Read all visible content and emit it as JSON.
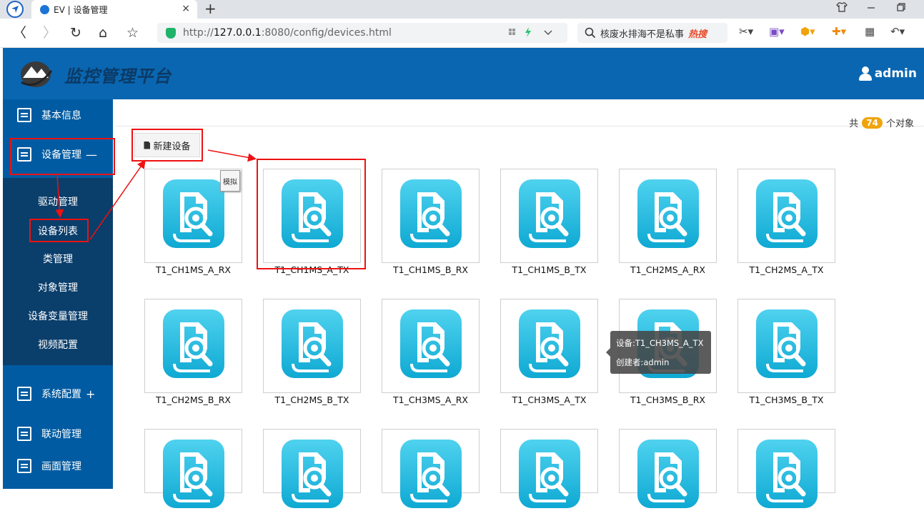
{
  "browser": {
    "tab_title": "EV | 设备管理",
    "tab_close": "×",
    "new_tab": "+",
    "url_scheme": "http://",
    "url_host": "127.0.0.1",
    "url_rest": ":8080/config/devices.html",
    "search_text": "核废水排海不是私事",
    "search_hot": "热搜",
    "nav": {
      "back": "〈",
      "forward": "〉",
      "reload": "↻",
      "home": "⌂",
      "star": "☆"
    },
    "icons": [
      "cut-icon",
      "translate-icon",
      "coin-icon",
      "game-icon",
      "apps-icon",
      "undo-icon"
    ]
  },
  "header": {
    "title": "监控管理平台",
    "user": "admin"
  },
  "sidebar": {
    "items": [
      {
        "label": "基本信息",
        "sign": ""
      },
      {
        "label": "设备管理",
        "sign": "—"
      },
      {
        "label": "系统配置",
        "sign": "+"
      },
      {
        "label": "联动管理",
        "sign": ""
      },
      {
        "label": "画面管理",
        "sign": ""
      }
    ],
    "submenu": [
      "驱动管理",
      "设备列表",
      "类管理",
      "对象管理",
      "设备变量管理",
      "视频配置"
    ]
  },
  "toolbar": {
    "new_device": "新建设备"
  },
  "summary": {
    "prefix": "共",
    "count": "74",
    "suffix": "个对象"
  },
  "sim_badge": "模拟",
  "devices": [
    "T1_CH1MS_A_RX",
    "T1_CH1MS_A_TX",
    "T1_CH1MS_B_RX",
    "T1_CH1MS_B_TX",
    "T1_CH2MS_A_RX",
    "T1_CH2MS_A_TX",
    "T1_CH2MS_B_RX",
    "T1_CH2MS_B_TX",
    "T1_CH3MS_A_RX",
    "T1_CH3MS_A_TX",
    "T1_CH3MS_B_RX",
    "T1_CH3MS_B_TX"
  ],
  "tooltip": {
    "device": "设备:T1_CH3MS_A_TX",
    "creator": "创建者:admin"
  },
  "colors": {
    "header_bg": "#0a66b0",
    "sidebar_bg": "#005ba2",
    "submenu_bg": "#0a3e6b",
    "icon_cyan": "#1db7dc",
    "annotation_red": "#ee1111",
    "badge_orange": "#f0a30a"
  }
}
